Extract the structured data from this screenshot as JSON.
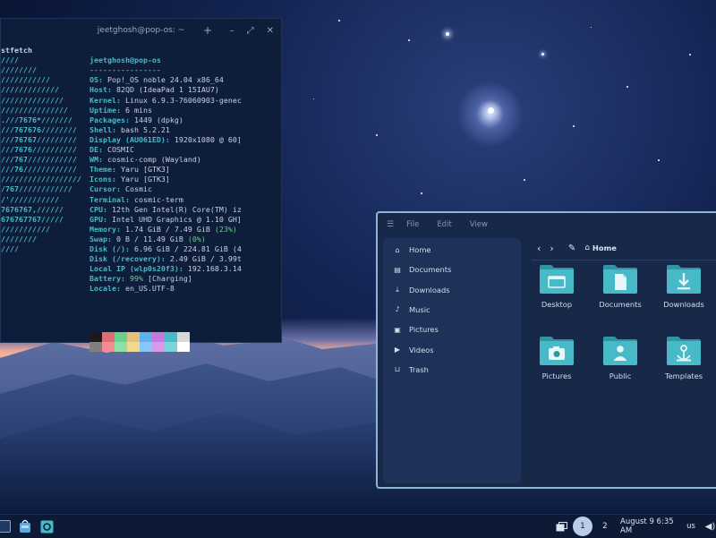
{
  "terminal": {
    "title": "jeetghosh@pop-os: ~",
    "new_tab": "+",
    "minimize": "–",
    "maximize": "⤢",
    "close": "✕",
    "logo_lines": [
      "stfetch",
      "////",
      "////////",
      "///////////",
      "/////////////",
      "//////////////",
      "///////////////",
      ".///7676*///////",
      "///767676////////",
      "///76767/////////",
      "///7676//////////",
      "///767///////////",
      "///76////////////",
      "//////////////////",
      "/767////////////",
      "/'///////////",
      "7676767,//////",
      "676767767/////",
      "///////////",
      "////////",
      "////"
    ],
    "user_host": "jeetghosh@pop-os",
    "separator": "----------------",
    "info": [
      {
        "key": "OS:",
        "value": " Pop!_OS noble 24.04 x86_64"
      },
      {
        "key": "Host:",
        "value": " 82QD (IdeaPad 1 15IAU7)"
      },
      {
        "key": "Kernel:",
        "value": " Linux 6.9.3-76060903-genec"
      },
      {
        "key": "Uptime:",
        "value": " 6 mins"
      },
      {
        "key": "Packages:",
        "value": " 1449 (dpkg)"
      },
      {
        "key": "Shell:",
        "value": " bash 5.2.21"
      },
      {
        "key": "Display (AUO61ED):",
        "value": " 1920x1080 @ 60]"
      },
      {
        "key": "DE:",
        "value": " COSMIC"
      },
      {
        "key": "WM:",
        "value": " cosmic-comp (Wayland)"
      },
      {
        "key": "Theme:",
        "value": " Yaru [GTK3]"
      },
      {
        "key": "Icons:",
        "value": " Yaru [GTK3]"
      },
      {
        "key": "Cursor:",
        "value": " Cosmic"
      },
      {
        "key": "Terminal:",
        "value": " cosmic-term"
      },
      {
        "key": "CPU:",
        "value": " 12th Gen Intel(R) Core(TM) iz"
      },
      {
        "key": "GPU:",
        "value": " Intel UHD Graphics @ 1.10 GH]"
      },
      {
        "key": "Memory:",
        "value": " 1.74 GiB / 7.49 GiB ",
        "pct": "(23%)"
      },
      {
        "key": "Swap:",
        "value": " 0 B / 11.49 GiB ",
        "pct": "(0%)"
      },
      {
        "key": "Disk (/):",
        "value": " 6.96 GiB / 224.81 GiB (4"
      },
      {
        "key": "Disk (/recovery):",
        "value": " 2.49 GiB / 3.99t"
      },
      {
        "key": "Local IP (wlp0s20f3):",
        "value": " 192.168.3.14"
      },
      {
        "key": "Battery:",
        "value": " ",
        "pct": "99%",
        "value2": " [Charging]"
      },
      {
        "key": "Locale:",
        "value": " en_US.UTF-8"
      }
    ],
    "palette_top": [
      "#1a1a1a",
      "#e06c75",
      "#6bcf8e",
      "#e5c07b",
      "#61afef",
      "#c678dd",
      "#48b9c7",
      "#d8d8d8"
    ],
    "palette_bottom": [
      "#7f7f7f",
      "#f28b92",
      "#8fe0a8",
      "#f2d98f",
      "#8ac6f5",
      "#d79ae8",
      "#7ad3de",
      "#ffffff"
    ]
  },
  "file_manager": {
    "menu": [
      "File",
      "Edit",
      "View"
    ],
    "breadcrumb": "Home",
    "sidebar": [
      {
        "label": "Home",
        "icon": "home-icon",
        "glyph": "⌂"
      },
      {
        "label": "Documents",
        "icon": "document-icon",
        "glyph": "▤"
      },
      {
        "label": "Downloads",
        "icon": "download-icon",
        "glyph": "⤓"
      },
      {
        "label": "Music",
        "icon": "music-icon",
        "glyph": "♪"
      },
      {
        "label": "Pictures",
        "icon": "picture-icon",
        "glyph": "▣"
      },
      {
        "label": "Videos",
        "icon": "video-icon",
        "glyph": "▶"
      },
      {
        "label": "Trash",
        "icon": "trash-icon",
        "glyph": "⊔"
      }
    ],
    "folders": [
      {
        "label": "Desktop",
        "icon": "desktop-folder-icon"
      },
      {
        "label": "Documents",
        "icon": "documents-folder-icon"
      },
      {
        "label": "Downloads",
        "icon": "downloads-folder-icon"
      },
      {
        "label": "Pictures",
        "icon": "pictures-folder-icon"
      },
      {
        "label": "Public",
        "icon": "public-folder-icon"
      },
      {
        "label": "Templates",
        "icon": "templates-folder-icon"
      }
    ],
    "colors": {
      "folder": "#48b9c7",
      "folder_dark": "#2f95a5",
      "border": "#8fb4dc"
    }
  },
  "taskbar": {
    "workspace_1": "1",
    "workspace_2": "2",
    "datetime": "August 9 6:35 AM",
    "keyboard": "us"
  }
}
